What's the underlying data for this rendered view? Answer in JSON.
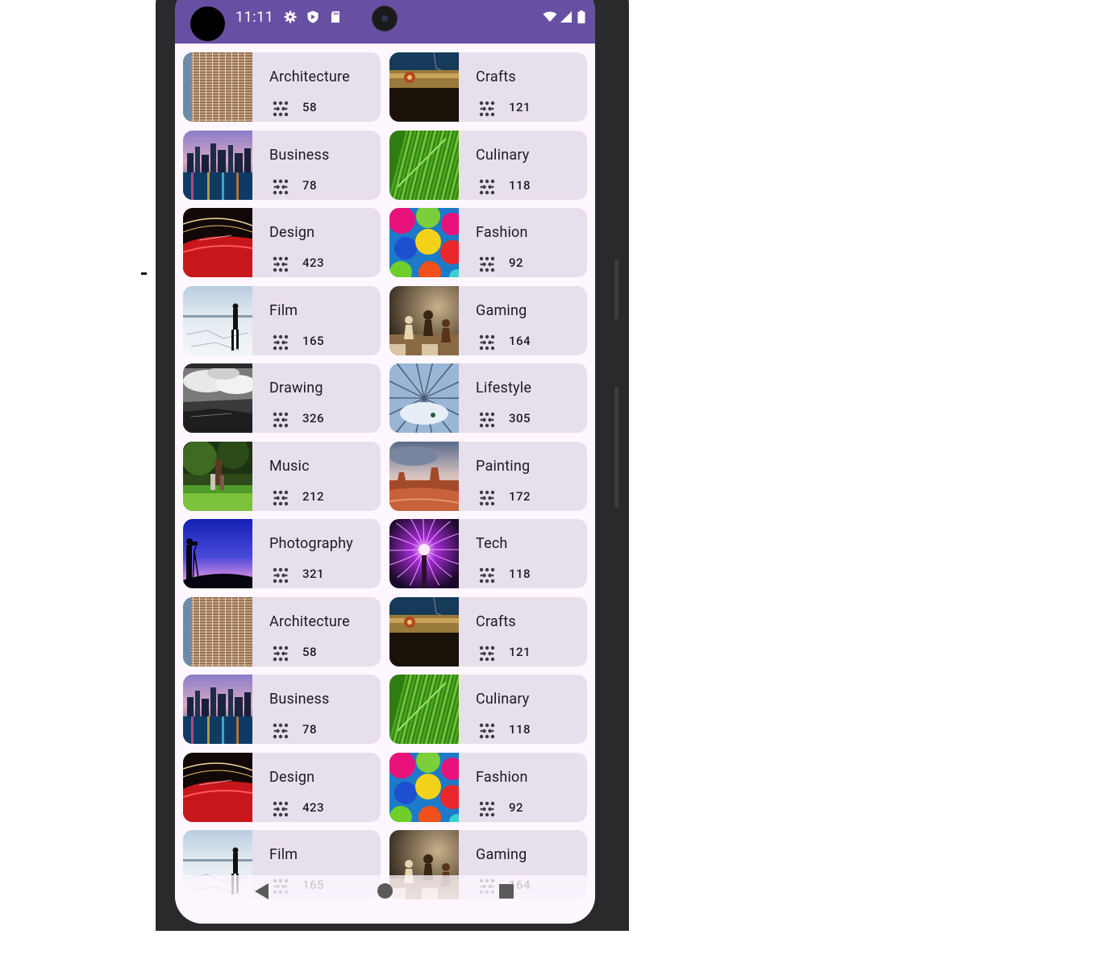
{
  "status_bar": {
    "time": "11:11",
    "left_icons": [
      "gear-icon",
      "shield-icon",
      "sd-card-icon"
    ],
    "right_icons": [
      "wifi-icon",
      "signal-icon",
      "battery-icon"
    ]
  },
  "count_icon": "dots-grid-icon",
  "categories": [
    {
      "label": "Architecture",
      "count": "58",
      "thumb": "architecture-image"
    },
    {
      "label": "Crafts",
      "count": "121",
      "thumb": "crafts-image"
    },
    {
      "label": "Business",
      "count": "78",
      "thumb": "business-image"
    },
    {
      "label": "Culinary",
      "count": "118",
      "thumb": "culinary-image"
    },
    {
      "label": "Design",
      "count": "423",
      "thumb": "design-image"
    },
    {
      "label": "Fashion",
      "count": "92",
      "thumb": "fashion-image"
    },
    {
      "label": "Film",
      "count": "165",
      "thumb": "film-image"
    },
    {
      "label": "Gaming",
      "count": "164",
      "thumb": "gaming-image"
    },
    {
      "label": "Drawing",
      "count": "326",
      "thumb": "drawing-image"
    },
    {
      "label": "Lifestyle",
      "count": "305",
      "thumb": "lifestyle-image"
    },
    {
      "label": "Music",
      "count": "212",
      "thumb": "music-image"
    },
    {
      "label": "Painting",
      "count": "172",
      "thumb": "painting-image"
    },
    {
      "label": "Photography",
      "count": "321",
      "thumb": "photography-image"
    },
    {
      "label": "Tech",
      "count": "118",
      "thumb": "tech-image"
    },
    {
      "label": "Architecture",
      "count": "58",
      "thumb": "architecture-image"
    },
    {
      "label": "Crafts",
      "count": "121",
      "thumb": "crafts-image"
    },
    {
      "label": "Business",
      "count": "78",
      "thumb": "business-image"
    },
    {
      "label": "Culinary",
      "count": "118",
      "thumb": "culinary-image"
    },
    {
      "label": "Design",
      "count": "423",
      "thumb": "design-image"
    },
    {
      "label": "Fashion",
      "count": "92",
      "thumb": "fashion-image"
    },
    {
      "label": "Film",
      "count": "165",
      "thumb": "film-image"
    },
    {
      "label": "Gaming",
      "count": "164",
      "thumb": "gaming-image"
    }
  ],
  "nav_bar": {
    "icons": [
      "back-icon",
      "home-icon",
      "recents-icon"
    ]
  },
  "colors": {
    "status_bar": "#6750a4",
    "card": "#e8dfec",
    "background": "#fef7ff"
  }
}
